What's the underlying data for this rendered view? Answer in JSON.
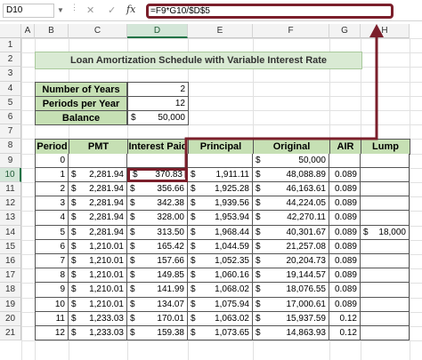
{
  "formula_bar": {
    "name_box": "D10",
    "formula": "=F9*G10/$D$5"
  },
  "columns": [
    "A",
    "B",
    "C",
    "D",
    "E",
    "F",
    "G",
    "H"
  ],
  "rows": [
    "1",
    "2",
    "3",
    "4",
    "5",
    "6",
    "7",
    "8",
    "9",
    "10",
    "11",
    "12",
    "13",
    "14",
    "15",
    "16",
    "17",
    "18",
    "19",
    "20",
    "21"
  ],
  "selected": {
    "column": "D",
    "row": "10"
  },
  "title": "Loan Amortization Schedule with Variable Interest Rate",
  "params": [
    {
      "label": "Number of Years",
      "value": "2",
      "currency": ""
    },
    {
      "label": "Periods per Year",
      "value": "12",
      "currency": ""
    },
    {
      "label": "Balance",
      "value": "50,000",
      "currency": "$"
    }
  ],
  "table": {
    "headers": [
      "Period",
      "PMT",
      "Interest Paid",
      "Principal Paid",
      "Original Balance",
      "AIR",
      "Lump Sum"
    ],
    "rows": [
      [
        "0",
        "",
        "",
        "",
        "50,000",
        "",
        ""
      ],
      [
        "1",
        "2,281.94",
        "370.83",
        "1,911.11",
        "48,088.89",
        "0.089",
        ""
      ],
      [
        "2",
        "2,281.94",
        "356.66",
        "1,925.28",
        "46,163.61",
        "0.089",
        ""
      ],
      [
        "3",
        "2,281.94",
        "342.38",
        "1,939.56",
        "44,224.05",
        "0.089",
        ""
      ],
      [
        "4",
        "2,281.94",
        "328.00",
        "1,953.94",
        "42,270.11",
        "0.089",
        ""
      ],
      [
        "5",
        "2,281.94",
        "313.50",
        "1,968.44",
        "40,301.67",
        "0.089",
        "18,000"
      ],
      [
        "6",
        "1,210.01",
        "165.42",
        "1,044.59",
        "21,257.08",
        "0.089",
        ""
      ],
      [
        "7",
        "1,210.01",
        "157.66",
        "1,052.35",
        "20,204.73",
        "0.089",
        ""
      ],
      [
        "8",
        "1,210.01",
        "149.85",
        "1,060.16",
        "19,144.57",
        "0.089",
        ""
      ],
      [
        "9",
        "1,210.01",
        "141.99",
        "1,068.02",
        "18,076.55",
        "0.089",
        ""
      ],
      [
        "10",
        "1,210.01",
        "134.07",
        "1,075.94",
        "17,000.61",
        "0.089",
        ""
      ],
      [
        "11",
        "1,233.03",
        "170.01",
        "1,063.02",
        "15,937.59",
        "0.12",
        ""
      ],
      [
        "12",
        "1,233.03",
        "159.38",
        "1,073.65",
        "14,863.93",
        "0.12",
        ""
      ]
    ]
  },
  "icons": {
    "close": "x-icon",
    "enter": "check-icon",
    "function": "fx-icon"
  },
  "colors": {
    "header_green": "#c6e0b4",
    "title_green": "#d9ead3",
    "highlight": "#7b1f2b"
  }
}
